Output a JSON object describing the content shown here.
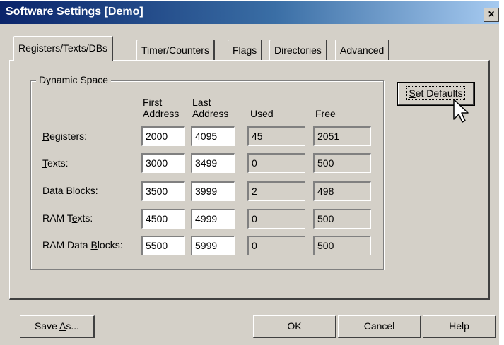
{
  "window": {
    "title": "Software Settings [Demo]",
    "close_label": "×"
  },
  "tabs": [
    {
      "label": "Registers/Texts/DBs",
      "active": true
    },
    {
      "label": "Timer/Counters",
      "active": false
    },
    {
      "label": "Flags",
      "active": false
    },
    {
      "label": "Directories",
      "active": false
    },
    {
      "label": "Advanced",
      "active": false
    }
  ],
  "dynamic_space": {
    "title": "Dynamic Space",
    "headers": {
      "first_line1": "First",
      "first_line2": "Address",
      "last_line1": "Last",
      "last_line2": "Address",
      "used": "Used",
      "free": "Free"
    },
    "rows": [
      {
        "label_pre": "",
        "label_u": "R",
        "label_post": "egisters:",
        "first": "2000",
        "last": "4095",
        "used": "45",
        "free": "2051"
      },
      {
        "label_pre": "",
        "label_u": "T",
        "label_post": "exts:",
        "first": "3000",
        "last": "3499",
        "used": "0",
        "free": "500"
      },
      {
        "label_pre": "",
        "label_u": "D",
        "label_post": "ata Blocks:",
        "first": "3500",
        "last": "3999",
        "used": "2",
        "free": "498"
      },
      {
        "label_pre": "RAM T",
        "label_u": "e",
        "label_post": "xts:",
        "first": "4500",
        "last": "4999",
        "used": "0",
        "free": "500"
      },
      {
        "label_pre": "RAM Data ",
        "label_u": "B",
        "label_post": "locks:",
        "first": "5500",
        "last": "5999",
        "used": "0",
        "free": "500"
      }
    ]
  },
  "buttons": {
    "set_defaults_u": "S",
    "set_defaults_rest": "et Defaults",
    "save_as_pre": "Save ",
    "save_as_u": "A",
    "save_as_post": "s...",
    "ok": "OK",
    "cancel": "Cancel",
    "help": "Help"
  },
  "icons": {
    "cursor": "mouse-pointer-icon"
  }
}
